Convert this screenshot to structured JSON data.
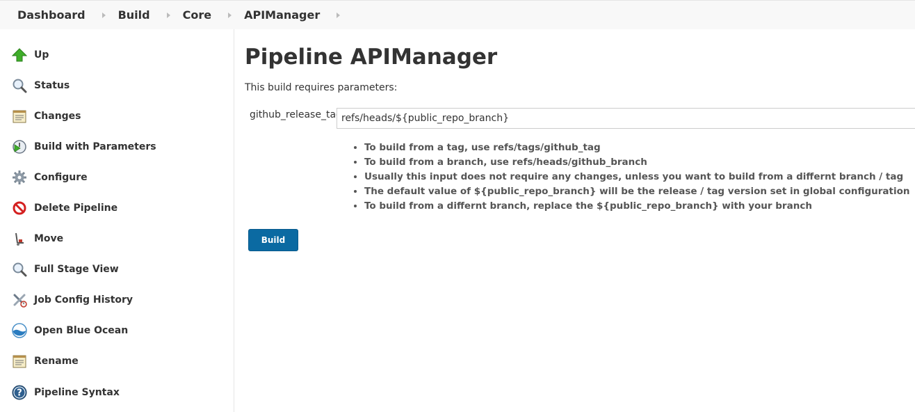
{
  "breadcrumb": {
    "items": [
      "Dashboard",
      "Build",
      "Core",
      "APIManager"
    ]
  },
  "sidebar": {
    "items": [
      {
        "label": "Up",
        "icon": "up-arrow-icon"
      },
      {
        "label": "Status",
        "icon": "magnifier-icon"
      },
      {
        "label": "Changes",
        "icon": "notepad-icon"
      },
      {
        "label": "Build with Parameters",
        "icon": "clock-play-icon"
      },
      {
        "label": "Configure",
        "icon": "gear-icon"
      },
      {
        "label": "Delete Pipeline",
        "icon": "no-entry-icon"
      },
      {
        "label": "Move",
        "icon": "hand-truck-icon"
      },
      {
        "label": "Full Stage View",
        "icon": "magnifier-icon"
      },
      {
        "label": "Job Config History",
        "icon": "tools-icon"
      },
      {
        "label": "Open Blue Ocean",
        "icon": "blue-ocean-icon"
      },
      {
        "label": "Rename",
        "icon": "notepad-icon"
      },
      {
        "label": "Pipeline Syntax",
        "icon": "help-icon"
      }
    ]
  },
  "main": {
    "title": "Pipeline APIManager",
    "intro": "This build requires parameters:",
    "parameter": {
      "name": "github_release_tag",
      "value": "refs/heads/${public_repo_branch}"
    },
    "description": [
      "To build from a tag, use refs/tags/github_tag",
      "To build from a branch, use refs/heads/github_branch",
      "Usually this input does not require any changes, unless you want to build from a differnt branch / tag",
      "The default value of ${public_repo_branch} will be the release / tag version set in global configuration",
      "To build from a differnt branch, replace the ${public_repo_branch} with your branch"
    ],
    "build_label": "Build"
  },
  "colors": {
    "button": "#0b6aa2",
    "breadcrumb_bg": "#f8f8f8"
  }
}
